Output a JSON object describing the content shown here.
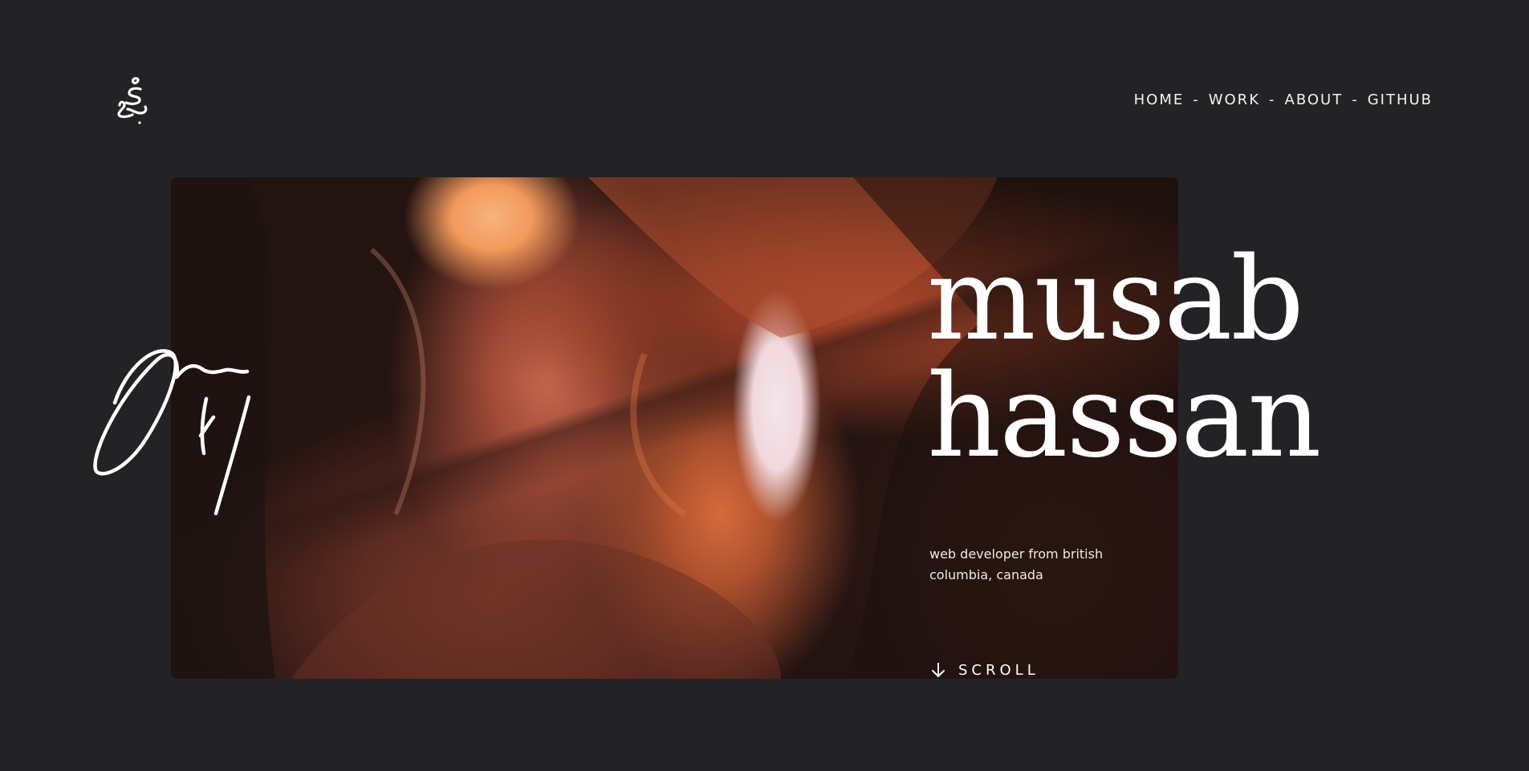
{
  "logo": {
    "icon": "arabic-monogram-icon"
  },
  "nav": {
    "items": [
      {
        "label": "HOME"
      },
      {
        "label": "WORK"
      },
      {
        "label": "ABOUT"
      },
      {
        "label": "GITHUB"
      }
    ],
    "separator": "-"
  },
  "hero": {
    "image": "antelope-canyon-photo",
    "signature": "handwritten-signature",
    "name_line1": "musab",
    "name_line2": "hassan",
    "tagline_line1": "web developer from british",
    "tagline_line2": "columbia, canada",
    "scroll_label": "SCROLL",
    "scroll_icon": "arrow-down-icon"
  },
  "colors": {
    "background": "#232325",
    "text": "#ffffff"
  }
}
